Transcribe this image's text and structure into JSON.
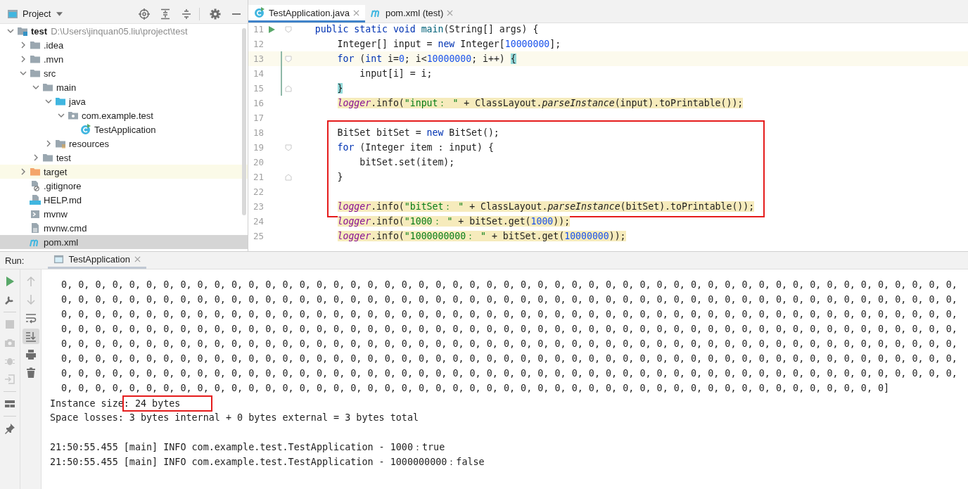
{
  "project_panel": {
    "title": "Project"
  },
  "project_tree": [
    {
      "label": "test",
      "note": "D:\\Users\\jinquan05.liu\\project\\test",
      "kind": "module",
      "expanded": true,
      "selected": false,
      "children": [
        {
          "label": ".idea",
          "kind": "folder",
          "expanded": false,
          "selected": false
        },
        {
          "label": ".mvn",
          "kind": "folder",
          "expanded": false,
          "selected": false
        },
        {
          "label": "src",
          "kind": "folder",
          "expanded": true,
          "selected": false,
          "children": [
            {
              "label": "main",
              "kind": "folder",
              "expanded": true,
              "selected": false,
              "children": [
                {
                  "label": "java",
                  "kind": "source",
                  "expanded": true,
                  "selected": false,
                  "children": [
                    {
                      "label": "com.example.test",
                      "kind": "package",
                      "expanded": true,
                      "selected": false,
                      "children": [
                        {
                          "label": "TestApplication",
                          "kind": "class",
                          "selected": false
                        }
                      ]
                    }
                  ]
                },
                {
                  "label": "resources",
                  "kind": "resources",
                  "expanded": false,
                  "selected": false
                }
              ]
            },
            {
              "label": "test",
              "kind": "folder",
              "expanded": false,
              "selected": false
            }
          ]
        },
        {
          "label": "target",
          "kind": "excluded",
          "expanded": false,
          "selected": false
        },
        {
          "label": ".gitignore",
          "kind": "ignored",
          "selected": false
        },
        {
          "label": "HELP.md",
          "kind": "markdown",
          "selected": false
        },
        {
          "label": "mvnw",
          "kind": "script",
          "selected": false
        },
        {
          "label": "mvnw.cmd",
          "kind": "text",
          "selected": false
        },
        {
          "label": "pom.xml",
          "kind": "maven",
          "selected": true
        }
      ]
    }
  ],
  "editor_tabs": [
    {
      "label": "TestApplication.java",
      "kind": "class",
      "selected": true
    },
    {
      "label": "pom.xml (test)",
      "kind": "maven",
      "selected": false
    }
  ],
  "code_blocks": [
    {
      "lines": [
        {
          "number": "11",
          "runnable": true,
          "fold_start": true,
          "tokens": [
            {
              "text": "    public static void ",
              "kind": "keyword"
            },
            {
              "text": "main",
              "kind": "method"
            },
            {
              "text": "(String[] args) {",
              "kind": "plain"
            }
          ]
        },
        {
          "number": "12",
          "tokens": [
            {
              "text": "        Integer[] input = ",
              "kind": "plain"
            },
            {
              "text": "new",
              "kind": "keyword"
            },
            {
              "text": " Integer[",
              "kind": "plain"
            },
            {
              "text": "10000000",
              "kind": "number"
            },
            {
              "text": "];",
              "kind": "plain"
            }
          ]
        },
        {
          "number": "13",
          "fold_start": true,
          "current": true,
          "changed": true,
          "tokens": [
            {
              "text": "        for",
              "kind": "keyword"
            },
            {
              "text": " (",
              "kind": "plain"
            },
            {
              "text": "int",
              "kind": "keyword"
            },
            {
              "text": " i=",
              "kind": "plain"
            },
            {
              "text": "0",
              "kind": "number"
            },
            {
              "text": "; i<",
              "kind": "plain"
            },
            {
              "text": "10000000",
              "kind": "number"
            },
            {
              "text": "; i++) ",
              "kind": "plain"
            },
            {
              "text": "{",
              "kind": "brace"
            }
          ]
        },
        {
          "number": "14",
          "changed": true,
          "tokens": [
            {
              "text": "            input[i] = i;",
              "kind": "plain"
            }
          ]
        },
        {
          "number": "15",
          "fold_end": true,
          "changed": true,
          "tokens": [
            {
              "text": "        }",
              "kind": "brace"
            }
          ]
        },
        {
          "number": "16",
          "warning": true,
          "tokens": [
            {
              "text": "        logger",
              "kind": "field"
            },
            {
              "text": ".info(",
              "kind": "plain"
            },
            {
              "text": "\"input： \"",
              "kind": "string"
            },
            {
              "text": " + ClassLayout.",
              "kind": "plain"
            },
            {
              "text": "parseInstance",
              "kind": "static"
            },
            {
              "text": "(input).toPrintable());",
              "kind": "plain"
            }
          ]
        },
        {
          "number": "17"
        }
      ]
    },
    {
      "framed": true,
      "lines": [
        {
          "number": "18",
          "tokens": [
            {
              "text": "        BitSet bitSet = ",
              "kind": "plain"
            },
            {
              "text": "new",
              "kind": "keyword"
            },
            {
              "text": " BitSet();",
              "kind": "plain"
            }
          ]
        },
        {
          "number": "19",
          "fold_start": true,
          "tokens": [
            {
              "text": "        for",
              "kind": "keyword"
            },
            {
              "text": " (Integer item : input) {",
              "kind": "plain"
            }
          ]
        },
        {
          "number": "20",
          "tokens": [
            {
              "text": "            bitSet.set(item);",
              "kind": "plain"
            }
          ]
        },
        {
          "number": "21",
          "fold_end": true,
          "tokens": [
            {
              "text": "        }",
              "kind": "plain"
            }
          ]
        },
        {
          "number": "22"
        },
        {
          "number": "23",
          "warning": true,
          "tokens": [
            {
              "text": "        logger",
              "kind": "field"
            },
            {
              "text": ".info(",
              "kind": "plain"
            },
            {
              "text": "\"bitSet： \"",
              "kind": "string"
            },
            {
              "text": " + ClassLayout.",
              "kind": "plain"
            },
            {
              "text": "parseInstance",
              "kind": "static"
            },
            {
              "text": "(bitSet).toPrintable());",
              "kind": "plain"
            }
          ]
        }
      ]
    },
    {
      "lines": [
        {
          "number": "24",
          "warning": true,
          "tokens": [
            {
              "text": "        logger",
              "kind": "field"
            },
            {
              "text": ".info(",
              "kind": "plain"
            },
            {
              "text": "\"1000： \"",
              "kind": "string"
            },
            {
              "text": " + bitSet.get(",
              "kind": "plain"
            },
            {
              "text": "1000",
              "kind": "number"
            },
            {
              "text": "));",
              "kind": "plain"
            }
          ]
        },
        {
          "number": "25",
          "warning": true,
          "tokens": [
            {
              "text": "        logger",
              "kind": "field"
            },
            {
              "text": ".info(",
              "kind": "plain"
            },
            {
              "text": "\"1000000000： \"",
              "kind": "string"
            },
            {
              "text": " + bitSet.get(",
              "kind": "plain"
            },
            {
              "text": "10000000",
              "kind": "number"
            },
            {
              "text": "));",
              "kind": "plain"
            }
          ]
        }
      ]
    }
  ],
  "run_panel": {
    "label": "Run:",
    "tabs": [
      {
        "label": "TestApplication",
        "selected": true
      }
    ]
  },
  "run_toolbar": [
    {
      "kind": "run",
      "disabled": false
    },
    {
      "kind": "settings",
      "disabled": false
    },
    {
      "kind": "stop",
      "disabled": true
    },
    {
      "kind": "camera",
      "disabled": true
    },
    {
      "kind": "bug",
      "disabled": true
    },
    {
      "kind": "exit",
      "disabled": true
    },
    {
      "kind": "layout",
      "disabled": false
    },
    {
      "kind": "pin",
      "disabled": false
    }
  ],
  "console_toolbar": [
    {
      "kind": "up",
      "disabled": true,
      "selected": false
    },
    {
      "kind": "down",
      "disabled": true,
      "selected": false
    },
    {
      "kind": "wrap",
      "disabled": false,
      "selected": false
    },
    {
      "kind": "scroll-end",
      "disabled": false,
      "selected": true
    },
    {
      "kind": "print",
      "disabled": false,
      "selected": false
    },
    {
      "kind": "trash",
      "disabled": false,
      "selected": false
    }
  ],
  "console_lines": [
    {
      "kind": "array",
      "text": "0, 0, 0, 0, 0, 0, 0, 0, 0, 0, 0, 0, 0, 0, 0, 0, 0, 0, 0, 0, 0, 0, 0, 0, 0, 0, 0, 0, 0, 0, 0, 0, 0, 0, 0, 0, 0, 0, 0, 0, 0, 0, 0, 0, 0, 0, 0, 0, 0, 0, 0, 0, 0,"
    },
    {
      "kind": "array",
      "text": "0, 0, 0, 0, 0, 0, 0, 0, 0, 0, 0, 0, 0, 0, 0, 0, 0, 0, 0, 0, 0, 0, 0, 0, 0, 0, 0, 0, 0, 0, 0, 0, 0, 0, 0, 0, 0, 0, 0, 0, 0, 0, 0, 0, 0, 0, 0, 0, 0, 0, 0, 0, 0,"
    },
    {
      "kind": "array",
      "text": "0, 0, 0, 0, 0, 0, 0, 0, 0, 0, 0, 0, 0, 0, 0, 0, 0, 0, 0, 0, 0, 0, 0, 0, 0, 0, 0, 0, 0, 0, 0, 0, 0, 0, 0, 0, 0, 0, 0, 0, 0, 0, 0, 0, 0, 0, 0, 0, 0, 0, 0, 0, 0,"
    },
    {
      "kind": "array",
      "text": "0, 0, 0, 0, 0, 0, 0, 0, 0, 0, 0, 0, 0, 0, 0, 0, 0, 0, 0, 0, 0, 0, 0, 0, 0, 0, 0, 0, 0, 0, 0, 0, 0, 0, 0, 0, 0, 0, 0, 0, 0, 0, 0, 0, 0, 0, 0, 0, 0, 0, 0, 0, 0,"
    },
    {
      "kind": "array",
      "text": "0, 0, 0, 0, 0, 0, 0, 0, 0, 0, 0, 0, 0, 0, 0, 0, 0, 0, 0, 0, 0, 0, 0, 0, 0, 0, 0, 0, 0, 0, 0, 0, 0, 0, 0, 0, 0, 0, 0, 0, 0, 0, 0, 0, 0, 0, 0, 0, 0, 0, 0, 0, 0,"
    },
    {
      "kind": "array",
      "text": "0, 0, 0, 0, 0, 0, 0, 0, 0, 0, 0, 0, 0, 0, 0, 0, 0, 0, 0, 0, 0, 0, 0, 0, 0, 0, 0, 0, 0, 0, 0, 0, 0, 0, 0, 0, 0, 0, 0, 0, 0, 0, 0, 0, 0, 0, 0, 0, 0, 0, 0, 0, 0,"
    },
    {
      "kind": "array",
      "text": "0, 0, 0, 0, 0, 0, 0, 0, 0, 0, 0, 0, 0, 0, 0, 0, 0, 0, 0, 0, 0, 0, 0, 0, 0, 0, 0, 0, 0, 0, 0, 0, 0, 0, 0, 0, 0, 0, 0, 0, 0, 0, 0, 0, 0, 0, 0, 0, 0, 0, 0, 0, 0,"
    },
    {
      "kind": "array",
      "text": "0, 0, 0, 0, 0, 0, 0, 0, 0, 0, 0, 0, 0, 0, 0, 0, 0, 0, 0, 0, 0, 0, 0, 0, 0, 0, 0, 0, 0, 0, 0, 0, 0, 0, 0, 0, 0, 0, 0, 0, 0, 0, 0, 0, 0, 0, 0, 0, 0]"
    },
    {
      "kind": "text",
      "parts": [
        {
          "text": "Instance size"
        },
        {
          "text": ": 24 bytes",
          "framed": true
        }
      ]
    },
    {
      "kind": "text",
      "parts": [
        {
          "text": "Space losses: 3 bytes internal + 0 bytes external = 3 bytes total"
        }
      ]
    },
    {
      "kind": "blank"
    },
    {
      "kind": "text",
      "parts": [
        {
          "text": "21:50:55.455 [main] INFO com.example.test.TestApplication - 1000：true"
        }
      ]
    },
    {
      "kind": "text",
      "parts": [
        {
          "text": "21:50:55.455 [main] INFO com.example.test.TestApplication - 1000000000：false"
        }
      ]
    }
  ]
}
